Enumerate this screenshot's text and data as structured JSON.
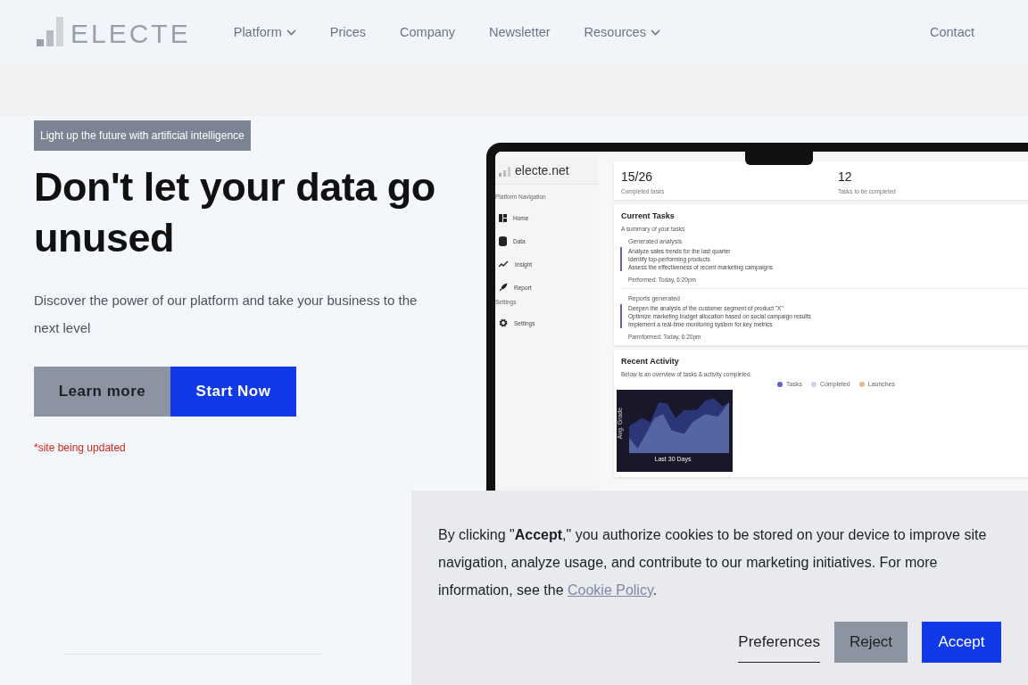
{
  "header": {
    "logo": "ELECTE",
    "nav": [
      {
        "label": "Platform",
        "has_menu": true
      },
      {
        "label": "Prices",
        "has_menu": false
      },
      {
        "label": "Company",
        "has_menu": false
      },
      {
        "label": "Newsletter",
        "has_menu": false
      },
      {
        "label": "Resources",
        "has_menu": true
      }
    ],
    "contact": "Contact"
  },
  "hero": {
    "tag": "Light up the future with artificial intelligence",
    "headline": "Don't let your data go unused",
    "subtitle": "Discover the power of our platform and take your business to the next level",
    "buttons": [
      {
        "label": "Learn more",
        "kind": "secondary"
      },
      {
        "label": "Start Now",
        "kind": "primary"
      }
    ],
    "note": "*site being updated"
  },
  "app_preview": {
    "brand": "electe.net",
    "nav_heading": "Platform Navigation",
    "nav": [
      {
        "label": "Home"
      },
      {
        "label": "Data"
      },
      {
        "label": "Insight"
      },
      {
        "label": "Report"
      }
    ],
    "settings_heading": "Settings",
    "settings_items": [
      {
        "label": "Settings"
      }
    ],
    "stats": [
      {
        "value": "15/26",
        "label": "Completed tasks"
      },
      {
        "value": "12",
        "label": "Tasks to be completed"
      }
    ],
    "current_tasks": {
      "title": "Current Tasks",
      "subtitle": "A summary of your tasks",
      "entries": [
        {
          "heading": "Generated analysis",
          "lines": [
            "Analyze sales trends for the last quarter",
            "Identify top-performing products",
            "Assess the effectiveness of recent marketing campaigns"
          ],
          "performed": "Performed: Today, 6:20pm"
        },
        {
          "heading": "Reports generated",
          "lines": [
            "Deepen the analysis of the customer segment of product \"X\"",
            "Optimize marketing budget allocation based on social campaign results",
            "Implement a real-time monitoring system for key metrics"
          ],
          "performed": "Parmformed: Today, 6:20pm"
        }
      ]
    },
    "recent_activity": {
      "title": "Recent Activity",
      "subtitle": "Below is an overview of tasks & activity completed.",
      "legend": [
        {
          "label": "Tasks",
          "color": "#5b63c7"
        },
        {
          "label": "Completed",
          "color": "#c9d3ee"
        },
        {
          "label": "Launches",
          "color": "#e7b98f"
        }
      ],
      "chart_ylabel": "Avg. Grade",
      "chart_xlabel": "Last 30 Days"
    }
  },
  "cookie_banner": {
    "text_before": "By clicking \"**Accept**,\" you authorize cookies to be stored on your device to improve site navigation, analyze usage, and contribute to our marketing initiatives. For more information, see the ",
    "link": "Cookie Policy",
    "text_after": ".",
    "buttons": [
      {
        "label": "Preferences",
        "kind": "text"
      },
      {
        "label": "Reject",
        "kind": "secondary"
      },
      {
        "label": "Accept",
        "kind": "primary"
      }
    ]
  }
}
